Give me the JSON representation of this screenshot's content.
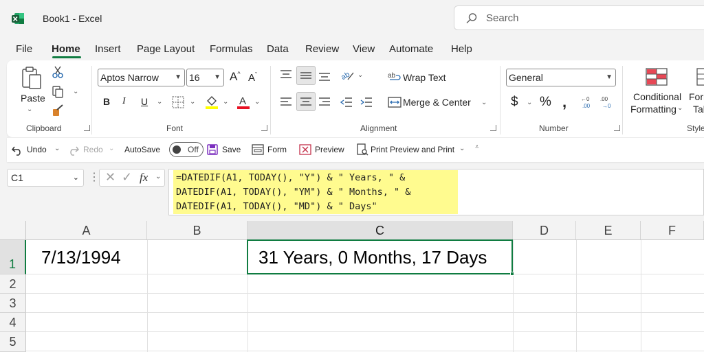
{
  "window": {
    "title": "Book1  -  Excel"
  },
  "search": {
    "placeholder": "Search"
  },
  "menu": {
    "tabs": [
      {
        "label": "File"
      },
      {
        "label": "Home"
      },
      {
        "label": "Insert"
      },
      {
        "label": "Page Layout"
      },
      {
        "label": "Formulas"
      },
      {
        "label": "Data"
      },
      {
        "label": "Review"
      },
      {
        "label": "View"
      },
      {
        "label": "Automate"
      },
      {
        "label": "Help"
      }
    ],
    "active": "Home"
  },
  "ribbon": {
    "clipboard": {
      "label": "Clipboard",
      "paste": "Paste"
    },
    "font": {
      "label": "Font",
      "family": "Aptos Narrow",
      "size": "16"
    },
    "alignment": {
      "label": "Alignment",
      "wrap_text": "Wrap Text",
      "merge_center": "Merge & Center"
    },
    "number": {
      "label": "Number",
      "format": "General"
    },
    "styles": {
      "label": "Style",
      "conditional": "Conditional",
      "formatting": "Formatting",
      "format_as_1": "Forr",
      "format_as_2": "Tab"
    }
  },
  "quick_access": {
    "undo": "Undo",
    "redo": "Redo",
    "autosave": "AutoSave",
    "autosave_state": "Off",
    "save": "Save",
    "form": "Form",
    "preview": "Preview",
    "print_preview": "Print Preview and Print"
  },
  "formula_bar": {
    "name_box": "C1",
    "formula_lines": [
      "=DATEDIF(A1, TODAY(), \"Y\") & \" Years, \" &",
      "DATEDIF(A1, TODAY(), \"YM\") & \" Months, \" &",
      "DATEDIF(A1, TODAY(), \"MD\") & \" Days\""
    ]
  },
  "sheet": {
    "columns": [
      "A",
      "B",
      "C",
      "D",
      "E",
      "F"
    ],
    "rows": [
      "1",
      "2",
      "3",
      "4",
      "5"
    ],
    "cells": {
      "A1": "7/13/1994",
      "C1": "31 Years, 0 Months, 17 Days"
    },
    "selected_cell": "C1"
  },
  "colors": {
    "accent": "#107c41",
    "formula_highlight": "#fffb8f"
  }
}
